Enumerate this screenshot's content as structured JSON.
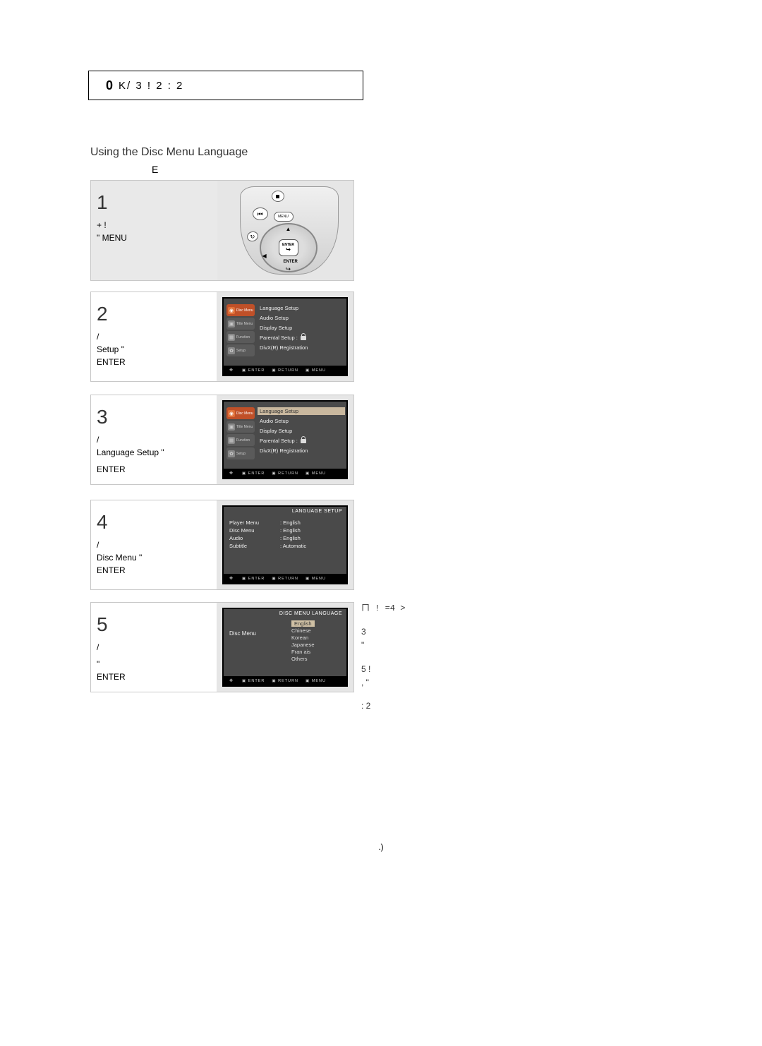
{
  "header": {
    "prefix": "0",
    "rest": " K/   3         !     2   :    2"
  },
  "title": "Using the Disc Menu Language",
  "subtitle": "E",
  "steps": {
    "s1": {
      "num": "1",
      "line1": "+             !",
      "line2": "\"                  MENU"
    },
    "s2": {
      "num": "2",
      "line1": "              /",
      "line2": " Setup \"",
      "line3": "       ENTER"
    },
    "s3": {
      "num": "3",
      "line1": "              /",
      "line2": " Language Setup \"",
      "line3": "ENTER"
    },
    "s4": {
      "num": "4",
      "line1": "              /",
      "line2": "    Disc Menu \"",
      "line3": "              ENTER"
    },
    "s5": {
      "num": "5",
      "line1": "               /",
      "line2": "      \"",
      "line3": " ENTER"
    }
  },
  "remote": {
    "enter_label": "ENTER",
    "menu_label": "MENU",
    "prev_glyph": "⏮",
    "return_glyph": "↻",
    "enter_glyph": "↪"
  },
  "osd": {
    "side": {
      "disc_menu": "Disc Menu",
      "title_menu": "Title Menu",
      "function": "Function",
      "setup": "Setup"
    },
    "main_items": {
      "language": "Language Setup",
      "audio": "Audio Setup",
      "display": "Display Setup",
      "parental": "Parental Setup :",
      "divx": "DivX(R) Registration"
    },
    "footer": {
      "enter": "ENTER",
      "return": "RETURN",
      "menu": "MENU"
    },
    "lang_setup_title": "LANGUAGE SETUP",
    "lang_setup_rows": {
      "player_menu": {
        "k": "Player Menu",
        "v": ": English"
      },
      "disc_menu": {
        "k": "Disc Menu",
        "v": ": English"
      },
      "audio": {
        "k": "Audio",
        "v": ": English"
      },
      "subtitle": {
        "k": "Subtitle",
        "v": ": Automatic"
      }
    },
    "disc_menu_title": "DISC MENU LANGUAGE",
    "disc_menu_label": "Disc Menu",
    "languages": {
      "english": "English",
      "chinese": "Chinese",
      "korean": "Korean",
      "japanese": "Japanese",
      "francais": "Fran  ais",
      "others": "Others"
    }
  },
  "sidenotes": {
    "n1": "ㄇ   !     =4     >",
    "n2": "       3",
    "n2b": "               \"",
    "n3": "             5        !",
    "n3b": "           ,                       \"",
    "n4": "   :  2"
  },
  "page_number": ".)"
}
